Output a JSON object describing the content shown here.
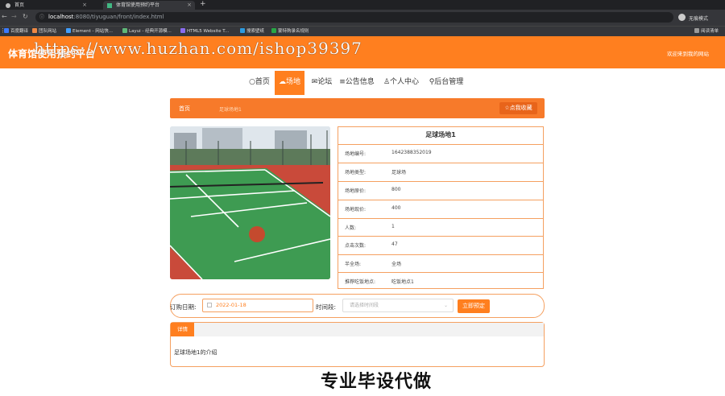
{
  "browser": {
    "tabs": [
      {
        "title": "首页"
      },
      {
        "title": "体育馆使用预约平台"
      }
    ],
    "url_host": "localhost",
    "url_path": ":8080/tiyuguan/front/index.html",
    "profile": "无痕模式",
    "bookmarks": [
      "百度翻译",
      "团队网站",
      "Element - 网站快...",
      "Layui - 经典开源模...",
      "HTML5 Website T...",
      "搜索壁纸",
      "蒙特购录名规则"
    ],
    "reading_list": "阅读清单"
  },
  "site": {
    "title": "体育馆使用预约平台",
    "welcome": "欢迎来到我的网站",
    "watermark": "https://www.huzhan.com/ishop39397"
  },
  "nav": [
    {
      "label": "首页",
      "icon": "home-icon"
    },
    {
      "label": "场地",
      "icon": "cloud-icon",
      "active": true
    },
    {
      "label": "论坛",
      "icon": "chat-icon"
    },
    {
      "label": "公告信息",
      "icon": "list-icon"
    },
    {
      "label": "个人中心",
      "icon": "user-icon"
    },
    {
      "label": "后台管理",
      "icon": "link-icon"
    }
  ],
  "breadcrumb": {
    "home": "首页",
    "current": "足球场地1",
    "favorite": "点我收藏"
  },
  "venue": {
    "title": "足球场地1",
    "fields": [
      {
        "key": "场地编号:",
        "value": "1642388352019"
      },
      {
        "key": "场地类型:",
        "value": "足球场"
      },
      {
        "key": "场地原价:",
        "value": "800"
      },
      {
        "key": "场地现价:",
        "value": "400"
      },
      {
        "key": "人数:",
        "value": "1"
      },
      {
        "key": "点击次数:",
        "value": "47"
      },
      {
        "key": "半全场:",
        "value": "全场"
      },
      {
        "key": "推荐吃饭地点:",
        "value": "吃饭地点1"
      }
    ]
  },
  "booking": {
    "date_label": "订购日期:",
    "date_value": "2022-01-18",
    "time_label": "时间段:",
    "time_placeholder": "请选择时间段",
    "submit": "立即预定"
  },
  "details": {
    "tab": "详情",
    "content": "足球场地1的介绍"
  },
  "slogan": "专业毕设代做",
  "colors": {
    "accent": "#ff7f1f",
    "chrome": "#202124"
  }
}
